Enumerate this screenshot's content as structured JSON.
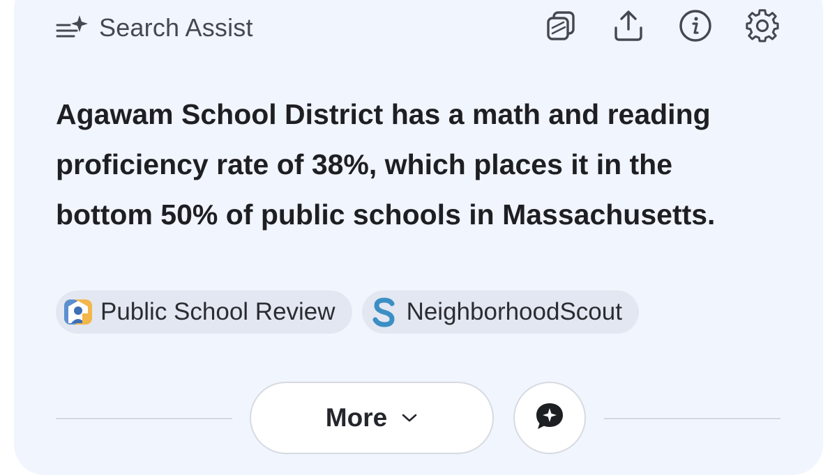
{
  "header": {
    "title": "Search Assist",
    "icon": "sparkle-lines-icon"
  },
  "toolbar": {
    "items": [
      {
        "name": "copy",
        "icon": "copy-icon"
      },
      {
        "name": "share",
        "icon": "share-icon"
      },
      {
        "name": "info",
        "icon": "info-icon"
      },
      {
        "name": "settings",
        "icon": "gear-icon"
      }
    ]
  },
  "answer": {
    "text": "Agawam School District has a math and reading proficiency rate of 38%, which places it in the bottom 50% of public schools in Massachusetts."
  },
  "sources": [
    {
      "label": "Public School Review",
      "icon": "public-school-review-logo"
    },
    {
      "label": "NeighborhoodScout",
      "icon": "neighborhoodscout-logo",
      "logo_letter": "S",
      "logo_color": "#3b8fc4"
    }
  ],
  "actions": {
    "more_label": "More",
    "chat_icon": "chat-sparkle-icon"
  },
  "colors": {
    "card_background": "#f1f5fd",
    "chip_background": "#e3e7f1",
    "text_primary": "#1e1f23"
  }
}
